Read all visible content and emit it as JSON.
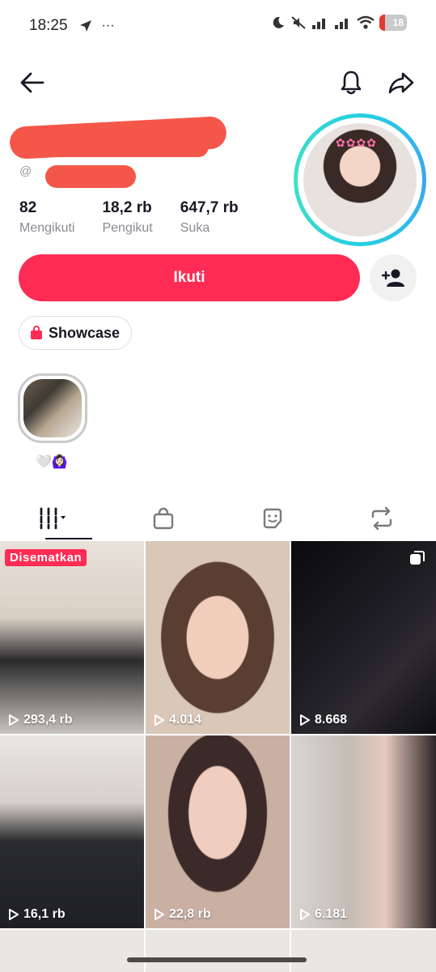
{
  "status_bar": {
    "time": "18:25",
    "more": "···",
    "battery_level": "18"
  },
  "profile": {
    "handle_prefix": "@",
    "stats": [
      {
        "value": "82",
        "label": "Mengikuti"
      },
      {
        "value": "18,2 rb",
        "label": "Pengikut"
      },
      {
        "value": "647,7 rb",
        "label": "Suka"
      }
    ],
    "follow_label": "Ikuti",
    "showcase_label": "Showcase",
    "highlight_label": "🤍🙆🏻‍♀️"
  },
  "tabs": [
    {
      "icon": "videos-grid-icon",
      "active": true
    },
    {
      "icon": "shopping-bag-icon",
      "active": false
    },
    {
      "icon": "sticker-icon",
      "active": false
    },
    {
      "icon": "repost-icon",
      "active": false
    }
  ],
  "videos": [
    {
      "views": "293,4 rb",
      "pinned_label": "Disematkan"
    },
    {
      "views": "4.014"
    },
    {
      "views": "8.668",
      "multi": true
    },
    {
      "views": "16,1 rb"
    },
    {
      "views": "22,8 rb"
    },
    {
      "views": "6.181"
    }
  ],
  "colors": {
    "accent": "#fe2c55",
    "avatar_ring": "#25d0e0",
    "redaction": "#f4574a"
  }
}
